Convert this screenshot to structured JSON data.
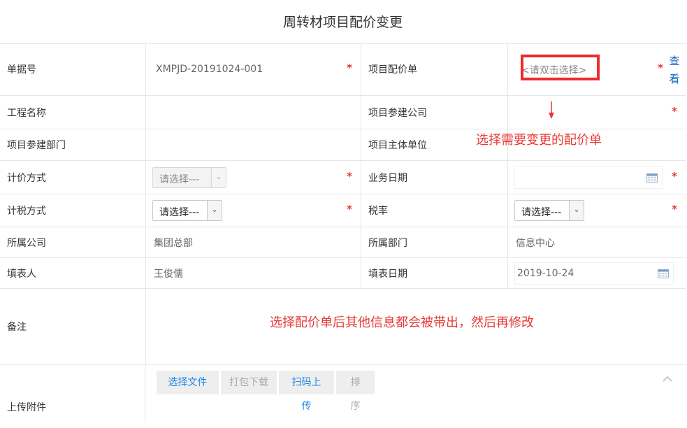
{
  "page": {
    "title": "周转材项目配价变更"
  },
  "fields": {
    "doc_no": {
      "label": "单据号",
      "value": "XMPJD-20191024-001"
    },
    "price_sheet": {
      "label": "项目配价单",
      "placeholder": "<请双击选择>",
      "view_label": "查看"
    },
    "project_name": {
      "label": "工程名称",
      "value": ""
    },
    "company": {
      "label": "项目参建公司",
      "value": ""
    },
    "dept": {
      "label": "项目参建部门",
      "value": ""
    },
    "main_unit": {
      "label": "项目主体单位",
      "value": ""
    },
    "pricing_method": {
      "label": "计价方式",
      "value": "请选择---"
    },
    "business_date": {
      "label": "业务日期",
      "value": ""
    },
    "tax_method": {
      "label": "计税方式",
      "value": "请选择---"
    },
    "tax_rate": {
      "label": "税率",
      "value": "请选择---"
    },
    "belong_company": {
      "label": "所属公司",
      "value": "集团总部"
    },
    "belong_dept": {
      "label": "所属部门",
      "value": "信息中心"
    },
    "filler": {
      "label": "填表人",
      "value": "王俊儒"
    },
    "fill_date": {
      "label": "填表日期",
      "value": "2019-10-24"
    },
    "remark": {
      "label": "备注"
    },
    "attachments": {
      "label": "上传附件"
    }
  },
  "required_mark": "*",
  "buttons": {
    "choose_file": "选择文件",
    "pack_download": "打包下载",
    "scan_upload": "扫码上传",
    "sort": "排 序"
  },
  "annotations": {
    "select_sheet": "选择需要变更的配价单",
    "after_select": "选择配价单后其他信息都会被带出，然后再修改"
  },
  "colors": {
    "required": "#e53935",
    "annotation": "#e53935",
    "link": "#1565c0",
    "button_active": "#1e88e5",
    "highlight_box": "#ee2b2b"
  }
}
